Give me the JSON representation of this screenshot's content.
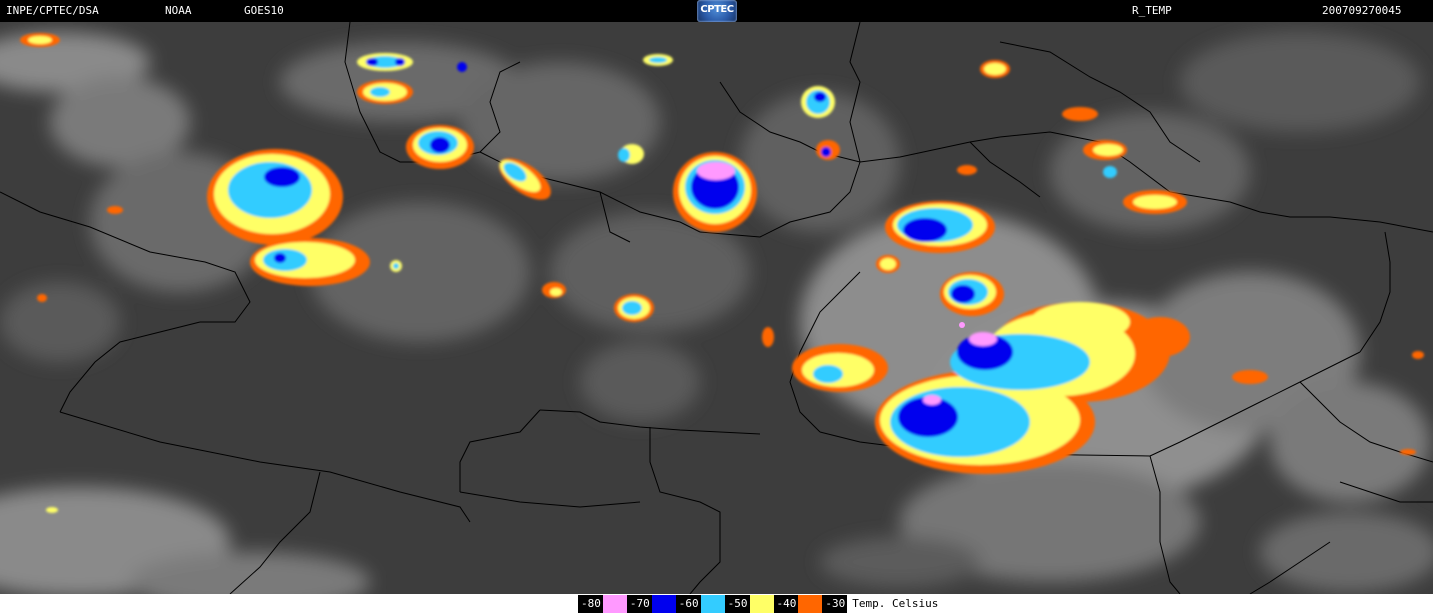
{
  "header": {
    "source": "INPE/CPTEC/DSA",
    "agency": "NOAA",
    "satellite": "GOES10",
    "logo_text": "CPTEC",
    "product": "R_TEMP",
    "datetime": "200709270045"
  },
  "legend": {
    "items": [
      {
        "label": "-80",
        "color": "#ff99ff",
        "name": "legend-item-minus-80"
      },
      {
        "label": "-70",
        "color": "#0000ee",
        "name": "legend-item-minus-70"
      },
      {
        "label": "-60",
        "color": "#33ccff",
        "name": "legend-item-minus-60"
      },
      {
        "label": "-50",
        "color": "#ffff66",
        "name": "legend-item-minus-50"
      },
      {
        "label": "-40",
        "color": "#ff6600",
        "name": "legend-item-minus-40"
      },
      {
        "label": "-30",
        "color": null,
        "name": "legend-item-minus-30"
      }
    ],
    "units": "Temp. Celsius"
  },
  "colors": {
    "background": "#3d3d3d",
    "cloud_light": "#bfbfbf",
    "border_lines": "#000000"
  }
}
